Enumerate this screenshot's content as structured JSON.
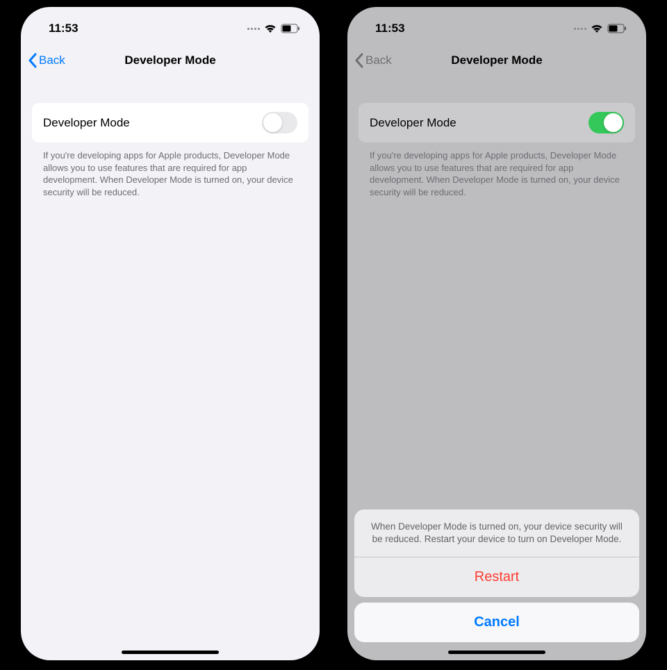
{
  "status": {
    "time": "11:53"
  },
  "nav": {
    "back_label": "Back",
    "title": "Developer Mode"
  },
  "setting": {
    "row_label": "Developer Mode",
    "description": "If you're developing apps for Apple products, Developer Mode allows you to use features that are required for app development. When Developer Mode is turned on, your device security will be reduced."
  },
  "actionsheet": {
    "message": "When Developer Mode is turned on, your device security will be reduced. Restart your device to turn on Developer Mode.",
    "restart_label": "Restart",
    "cancel_label": "Cancel"
  }
}
